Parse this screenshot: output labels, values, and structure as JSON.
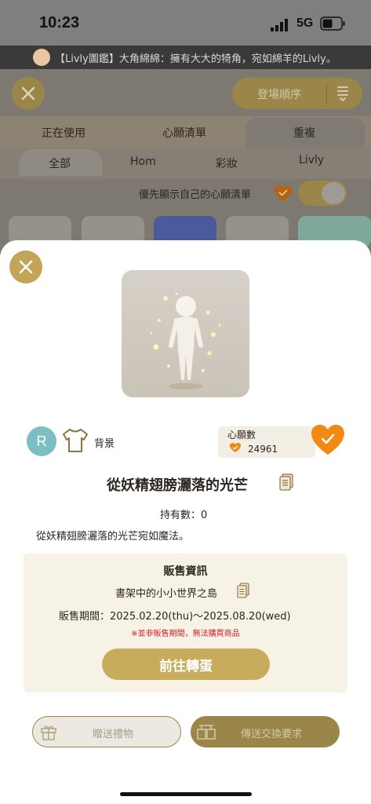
{
  "status_bar": {
    "time": "10:23",
    "network": "5G"
  },
  "ticker": {
    "text": "【Livly圖鑑】大角綿綿：擁有大大的犄角，宛如綿羊的Livly。"
  },
  "toolbar": {
    "sort_label": "登場順序"
  },
  "tabs": [
    {
      "label": "正在使用"
    },
    {
      "label": "心願清單"
    },
    {
      "label": "重複",
      "selected": true
    }
  ],
  "categories": [
    {
      "label": "全部",
      "selected": true
    },
    {
      "label": "Hom"
    },
    {
      "label": "彩妝"
    },
    {
      "label": "Livly"
    }
  ],
  "wishlist_toggle": {
    "label": "優先顯示自己的心願清單",
    "on": true
  },
  "item": {
    "rarity": "R",
    "category": "背景",
    "wish_title": "心願數",
    "wish_count": "24961",
    "name": "從妖精翅膀灑落的光芒",
    "owned": "持有數：0",
    "description": "從妖精翅膀灑落的光芒宛如魔法。"
  },
  "sale": {
    "title": "販售資訊",
    "venue": "書架中的小小世界之島",
    "period": "販售期間：2025.02.20(thu)～2025.08.20(wed)",
    "warning": "※並非販售期間，無法購買商品",
    "goto_label": "前往轉蛋"
  },
  "actions": {
    "gift_label": "贈送禮物",
    "trade_label": "傳送交換要求"
  },
  "colors": {
    "gold": "#c4a456",
    "heart_orange": "#f08a12",
    "warning_red": "#d0202a",
    "rarity_teal": "#7cbfc3"
  }
}
